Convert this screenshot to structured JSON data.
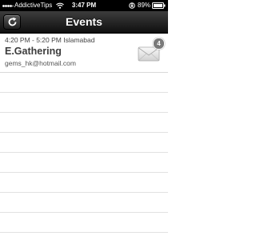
{
  "status_bar": {
    "carrier": "AddictiveTips",
    "time": "3:47 PM",
    "battery": "89%"
  },
  "nav": {
    "title": "Events",
    "refresh_icon": "refresh-icon"
  },
  "events": [
    {
      "time": "4:20 PM - 5:20 PM Islamabad",
      "title": "E.Gathering",
      "email": "gems_hk@hotmail.com",
      "badge": "4",
      "icon": "mail-icon"
    }
  ],
  "colors": {
    "status_bar": "#000000",
    "nav_bar": "#1e1e1e",
    "badge": "#7a7a7a"
  }
}
